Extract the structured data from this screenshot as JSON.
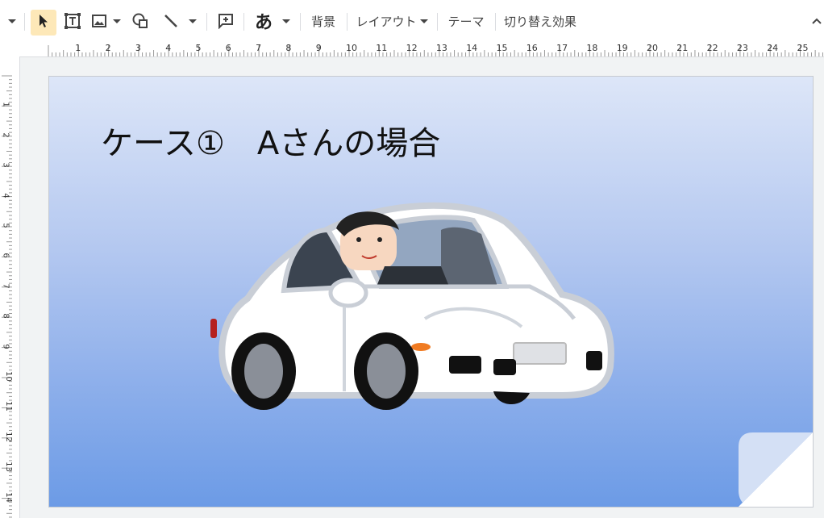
{
  "toolbar": {
    "japanese_char": "あ",
    "background_label": "背景",
    "layout_label": "レイアウト",
    "theme_label": "テーマ",
    "transition_label": "切り替え効果"
  },
  "ruler": {
    "horizontal": [
      "1",
      "2",
      "3",
      "4",
      "5",
      "6",
      "7",
      "8",
      "9",
      "10",
      "11",
      "12",
      "13",
      "14",
      "15",
      "16",
      "17",
      "18",
      "19",
      "20",
      "21",
      "22",
      "23",
      "24",
      "25"
    ],
    "vertical": [
      "1",
      "2",
      "3",
      "4",
      "5",
      "6",
      "7",
      "8",
      "9",
      "10",
      "11",
      "12",
      "13",
      "14"
    ]
  },
  "slide": {
    "title": "ケース①　Aさんの場合",
    "gradient_colors": [
      "#dde6f8",
      "#6c9be6"
    ]
  },
  "icons": [
    "chevron-down-icon",
    "select-cursor-icon",
    "text-box-icon",
    "image-icon",
    "shapes-icon",
    "line-icon",
    "comment-add-icon",
    "chevron-up-icon"
  ]
}
